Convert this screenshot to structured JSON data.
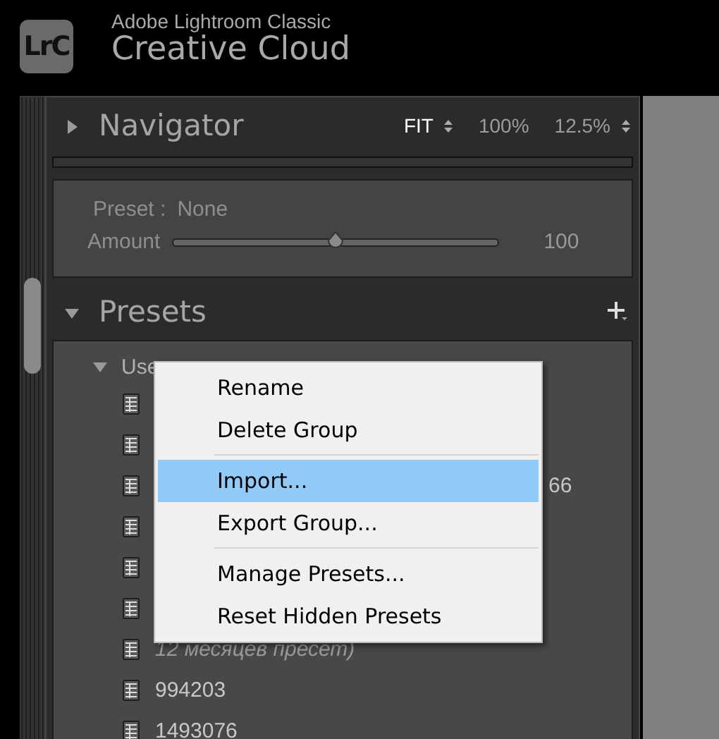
{
  "app": {
    "product": "Adobe Lightroom Classic",
    "subtitle": "Creative Cloud",
    "logo": "LrC"
  },
  "navigator": {
    "title": "Navigator",
    "expanded": false,
    "zoom_options": [
      {
        "label": "FIT",
        "selected": true,
        "stepper": true
      },
      {
        "label": "100%",
        "selected": false,
        "stepper": false
      },
      {
        "label": "12.5%",
        "selected": false,
        "stepper": true
      }
    ]
  },
  "preset_amount": {
    "preset_label": "Preset :",
    "preset_value": "None",
    "amount_label": "Amount",
    "level": 0.5,
    "reading": "100"
  },
  "presets": {
    "title": "Presets",
    "expanded": true,
    "groups": [
      {
        "label": "Use",
        "expanded": true,
        "children": [
          {
            "kind": "preset"
          },
          {
            "kind": "preset"
          },
          {
            "kind": "preset",
            "label": "66",
            "covered": true
          },
          {
            "kind": "preset"
          },
          {
            "kind": "preset"
          },
          {
            "kind": "preset"
          },
          {
            "kind": "preset",
            "label": "12 месяцев пресет)",
            "italic": true
          },
          {
            "kind": "preset",
            "label": "994203"
          },
          {
            "kind": "preset",
            "label": "1493076"
          }
        ]
      }
    ]
  },
  "context_menu": {
    "items": [
      {
        "kind": "item",
        "label": "Rename",
        "selected": false
      },
      {
        "kind": "item",
        "label": "Delete Group",
        "selected": false
      },
      {
        "kind": "separator"
      },
      {
        "kind": "item",
        "label": "Import...",
        "selected": true
      },
      {
        "kind": "item",
        "label": "Export Group...",
        "selected": false
      },
      {
        "kind": "separator"
      },
      {
        "kind": "item",
        "label": "Manage Presets...",
        "selected": false
      },
      {
        "kind": "item",
        "label": "Reset Hidden Presets",
        "selected": false
      }
    ]
  }
}
